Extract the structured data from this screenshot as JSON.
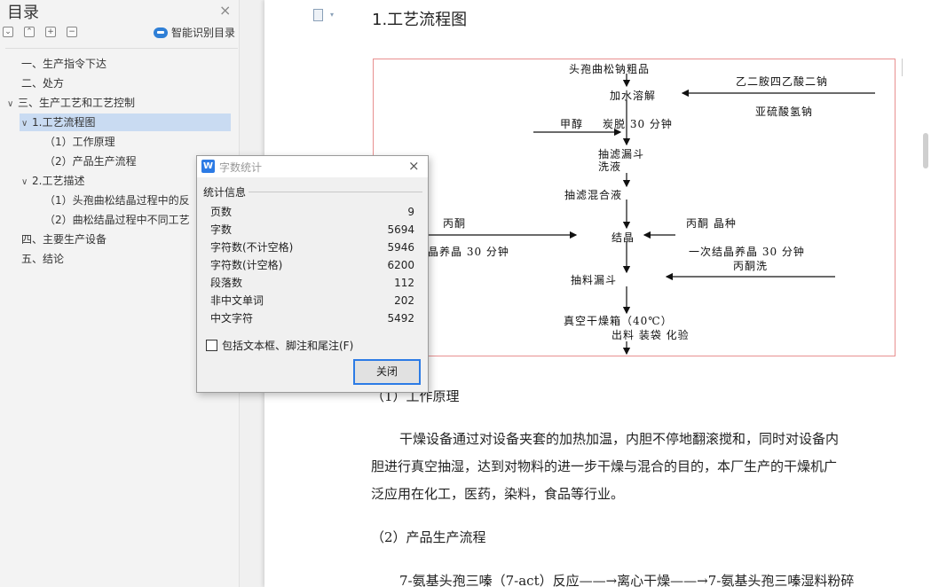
{
  "sidebar": {
    "title": "目录",
    "close_glyph": "×",
    "toolbar": [
      "⌄",
      "⌃",
      "+",
      "−"
    ],
    "smart_toc_label": "智能识别目录",
    "items": [
      {
        "chev": "",
        "label": "一、生产指令下达"
      },
      {
        "chev": "",
        "label": "二、处方"
      },
      {
        "chev": "∨",
        "label": "三、生产工艺和工艺控制"
      },
      {
        "chev": "∨",
        "label": "1.工艺流程图"
      },
      {
        "chev": "",
        "label": "（1）工作原理"
      },
      {
        "chev": "",
        "label": "（2）产品生产流程"
      },
      {
        "chev": "∨",
        "label": "2.工艺描述"
      },
      {
        "chev": "",
        "label": "（1）头孢曲松结晶过程中的反"
      },
      {
        "chev": "",
        "label": "（2）曲松结晶过程中不同工艺"
      },
      {
        "chev": "",
        "label": "四、主要生产设备"
      },
      {
        "chev": "",
        "label": "五、结论"
      }
    ]
  },
  "document": {
    "heading": "1.工艺流程图",
    "flowchart": {
      "labels": [
        "头孢曲松钠粗品",
        "乙二胺四乙酸二钠",
        "加水溶解",
        "亚硫酸氢钠",
        "甲醇",
        "炭脱 30 分钟",
        "抽滤漏斗",
        "洗液",
        "抽滤混合液",
        "丙酮",
        "丙酮  晶种",
        "结晶",
        "结晶养晶 30 分钟",
        "一次结晶养晶 30 分钟",
        "丙酮洗",
        "抽料漏斗",
        "真空干燥箱（40℃）",
        "出料  装袋  化验"
      ]
    },
    "section1_title": "（1）工作原理",
    "para1_lines": [
      "干燥设备通过对设备夹套的加热加温，内胆不停地翻滚搅和，同时对设备内",
      "胆进行真空抽湿，达到对物料的进一步干燥与混合的目的，本厂生产的干燥机广",
      "泛应用在化工，医药，染料，食品等行业。"
    ],
    "section2_title": "（2）产品生产流程",
    "para2_line": "7-氨基头孢三嗪（7-act）反应——→离心干燥——→7-氨基头孢三嗪湿料粉碎"
  },
  "dialog": {
    "logo": "W",
    "title": "字数统计",
    "close_glyph": "×",
    "section_label": "统计信息",
    "stats": [
      {
        "label": "页数",
        "value": "9"
      },
      {
        "label": "字数",
        "value": "5694"
      },
      {
        "label": "字符数(不计空格)",
        "value": "5946"
      },
      {
        "label": "字符数(计空格)",
        "value": "6200"
      },
      {
        "label": "段落数",
        "value": "112"
      },
      {
        "label": "非中文单词",
        "value": "202"
      },
      {
        "label": "中文字符",
        "value": "5492"
      }
    ],
    "checkbox_label": "包括文本框、脚注和尾注(F)",
    "checkbox_checked": false,
    "ok_label": "关闭"
  },
  "colors": {
    "accent": "#2c7be5",
    "selection": "#c9dbf2",
    "flowchart_border": "#e89090"
  }
}
